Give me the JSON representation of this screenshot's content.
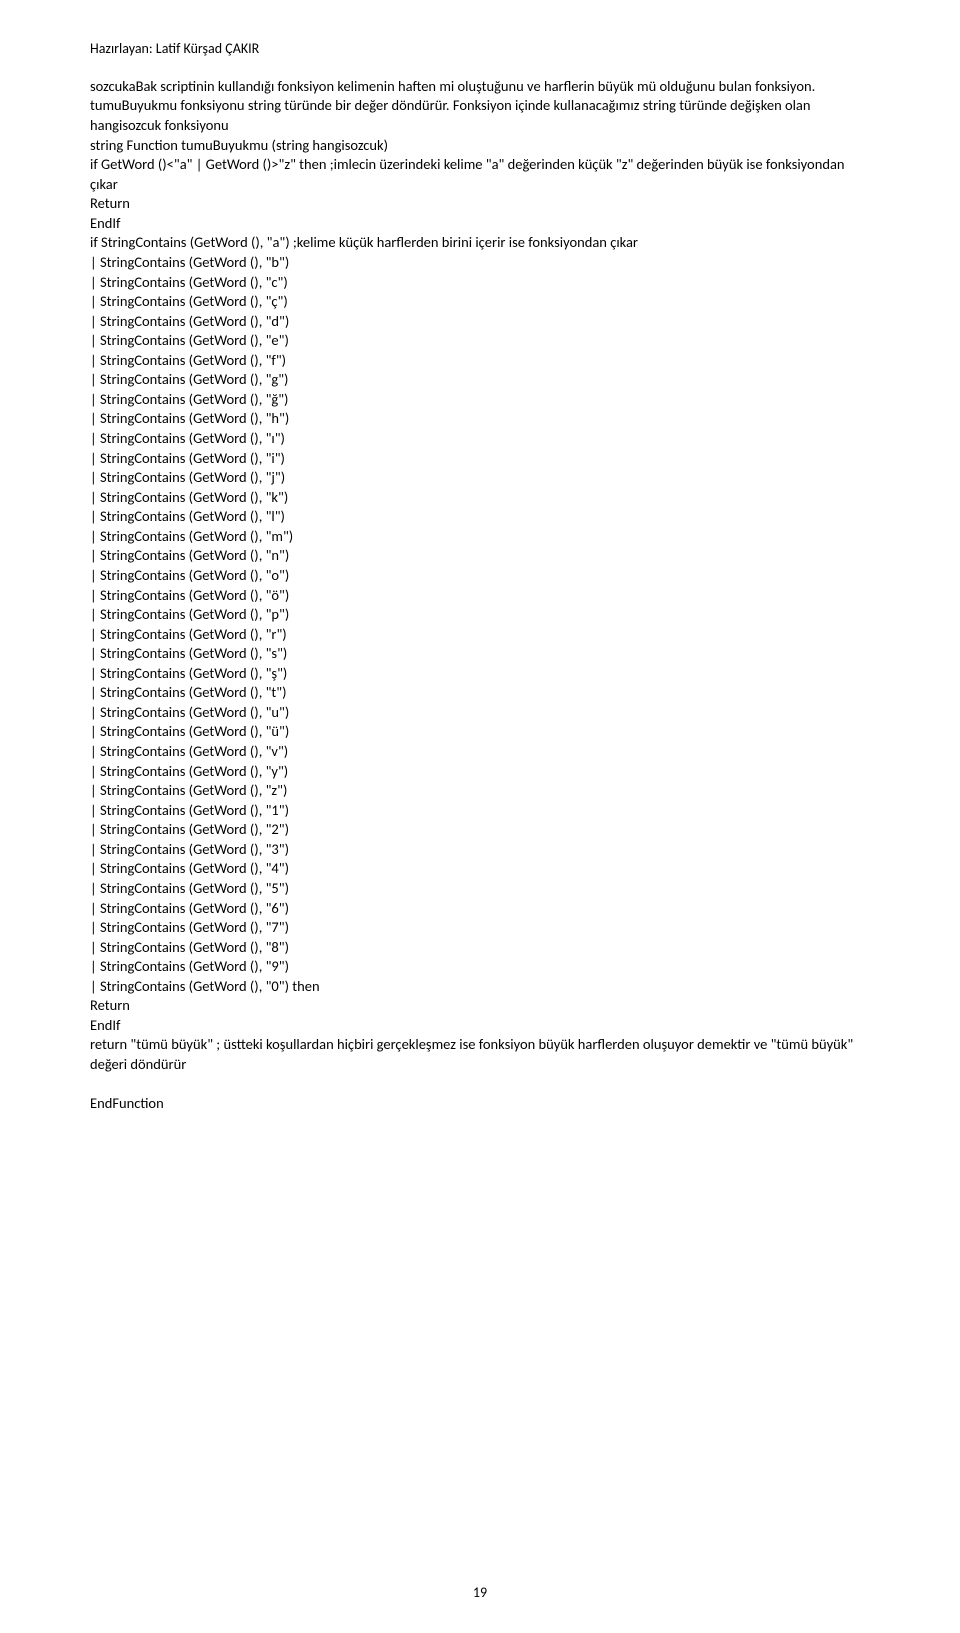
{
  "header": "Hazırlayan: Latif Kürşad ÇAKIR",
  "intro_para": "sozcukaBak scriptinin kullandığı fonksiyon kelimenin haften mi oluştuğunu ve harflerin büyük mü olduğunu bulan fonksiyon. tumuBuyukmu fonksiyonu string türünde bir değer döndürür. Fonksiyon içinde kullanacağımız string türünde değişken olan hangisozcuk fonksiyonu",
  "lines": [
    "string Function tumuBuyukmu (string hangisozcuk)",
    "if GetWord ()<\"a\" | GetWord ()>\"z\" then ;imlecin üzerindeki kelime \"a\" değerinden küçük \"z\" değerinden büyük ise fonksiyondan çıkar",
    "Return",
    "EndIf",
    "if StringContains (GetWord (), \"a\") ;kelime küçük harflerden birini içerir ise fonksiyondan çıkar",
    "| StringContains (GetWord (), \"b\")",
    "| StringContains (GetWord (), \"c\")",
    "| StringContains (GetWord (), \"ç\")",
    "| StringContains (GetWord (), \"d\")",
    "| StringContains (GetWord (), \"e\")",
    "| StringContains (GetWord (), \"f\")",
    "| StringContains (GetWord (), \"g\")",
    "| StringContains (GetWord (), \"ğ\")",
    "| StringContains (GetWord (), \"h\")",
    "| StringContains (GetWord (), \"ı\")",
    "| StringContains (GetWord (), \"i\")",
    "| StringContains (GetWord (), \"j\")",
    "| StringContains (GetWord (), \"k\")",
    "| StringContains (GetWord (), \"l\")",
    "| StringContains (GetWord (), \"m\")",
    "| StringContains (GetWord (), \"n\")",
    "| StringContains (GetWord (), \"o\")",
    "| StringContains (GetWord (), \"ö\")",
    "| StringContains (GetWord (), \"p\")",
    "| StringContains (GetWord (), \"r\")",
    "| StringContains (GetWord (), \"s\")",
    "| StringContains (GetWord (), \"ş\")",
    "| StringContains (GetWord (), \"t\")",
    "| StringContains (GetWord (), \"u\")",
    "| StringContains (GetWord (), \"ü\")",
    "| StringContains (GetWord (), \"v\")",
    "| StringContains (GetWord (), \"y\")",
    "| StringContains (GetWord (), \"z\")",
    "| StringContains (GetWord (), \"1\")",
    "| StringContains (GetWord (), \"2\")",
    "| StringContains (GetWord (), \"3\")",
    "| StringContains (GetWord (), \"4\")",
    "| StringContains (GetWord (), \"5\")",
    "| StringContains (GetWord (), \"6\")",
    "| StringContains (GetWord (), \"7\")",
    "| StringContains (GetWord (), \"8\")",
    "| StringContains (GetWord (), \"9\")",
    "| StringContains (GetWord (), \"0\") then",
    "Return",
    "EndIf",
    "return \"tümü büyük\" ; üstteki koşullardan hiçbiri gerçekleşmez ise fonksiyon büyük harflerden oluşuyor demektir ve \"tümü büyük\" değeri döndürür",
    "",
    "EndFunction"
  ],
  "page_number": "19"
}
